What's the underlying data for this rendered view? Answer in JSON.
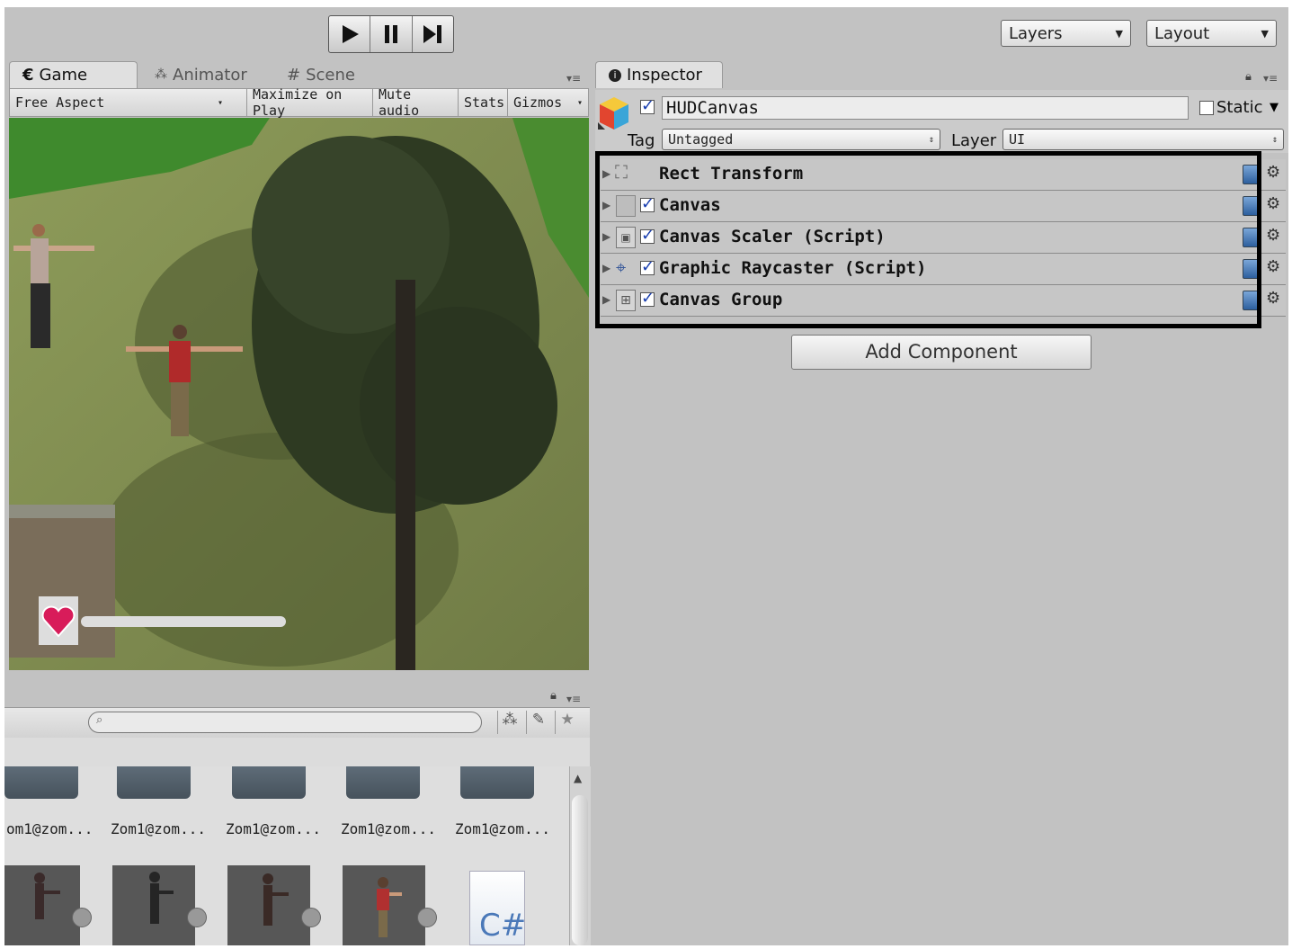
{
  "toolbar": {
    "layers_label": "Layers",
    "layout_label": "Layout"
  },
  "left_tabs": [
    {
      "label": "Game"
    },
    {
      "label": "Animator"
    },
    {
      "label": "Scene"
    }
  ],
  "game_bar": {
    "aspect": "Free Aspect",
    "maximize": "Maximize on Play",
    "mute": "Mute audio",
    "stats": "Stats",
    "gizmos": "Gizmos"
  },
  "inspector": {
    "tab_label": "Inspector",
    "object_name": "HUDCanvas",
    "static_label": "Static",
    "tag_label": "Tag",
    "tag_value": "Untagged",
    "layer_label": "Layer",
    "layer_value": "UI",
    "components": [
      {
        "label": "Rect Transform",
        "icon": "rect-transform-icon"
      },
      {
        "label": "Canvas",
        "icon": "canvas-icon"
      },
      {
        "label": "Canvas Scaler (Script)",
        "icon": "canvas-scaler-icon"
      },
      {
        "label": "Graphic Raycaster (Script)",
        "icon": "graphic-raycaster-icon"
      },
      {
        "label": "Canvas Group",
        "icon": "canvas-group-icon"
      }
    ],
    "add_component": "Add Component"
  },
  "project": {
    "search_placeholder": "",
    "assets": [
      {
        "label": "om1@zom..."
      },
      {
        "label": "Zom1@zom..."
      },
      {
        "label": "Zom1@zom..."
      },
      {
        "label": "Zom1@zom..."
      },
      {
        "label": "Zom1@zom..."
      }
    ],
    "script_icon_text": "C#"
  },
  "game_view": {
    "health_fraction": 1.0
  }
}
